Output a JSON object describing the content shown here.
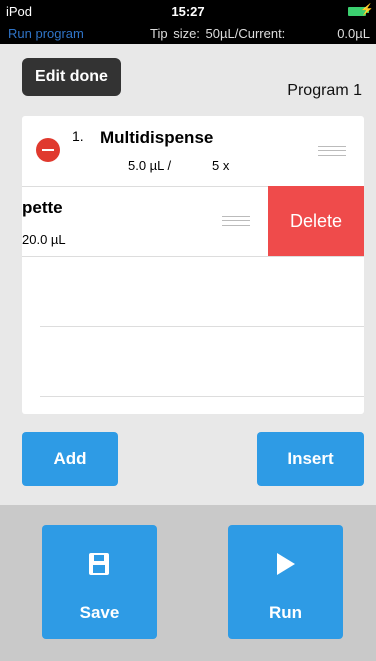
{
  "status": {
    "carrier": "iPod",
    "time": "15:27",
    "mode_label": "Run program",
    "tip_label": "Tip size:",
    "tip_value": "50µL/Current:",
    "current_value": "0.0µL"
  },
  "header": {
    "edit_done_label": "Edit done",
    "program_name": "Program 1"
  },
  "steps": [
    {
      "number": "1.",
      "name": "Multidispense",
      "volume": "5.0 µL /",
      "count": "5 x"
    },
    {
      "name": "pette",
      "volume": "20.0 µL",
      "delete_label": "Delete"
    }
  ],
  "actions": {
    "add_label": "Add",
    "insert_label": "Insert"
  },
  "bottom": {
    "save_label": "Save",
    "run_label": "Run"
  },
  "colors": {
    "accent": "#2e9be5",
    "delete": "#ef4b4b",
    "remove": "#e0392e"
  }
}
